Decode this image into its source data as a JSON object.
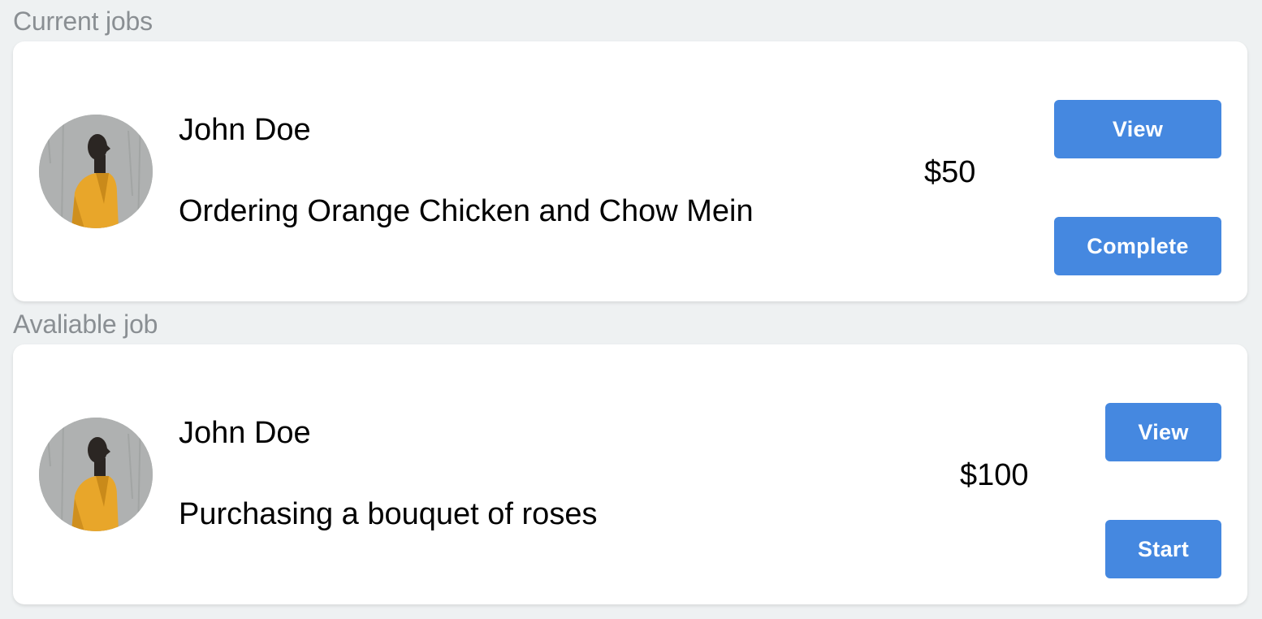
{
  "sections": {
    "current": {
      "title": "Current jobs",
      "job": {
        "name": "John Doe",
        "description": "Ordering Orange Chicken and Chow Mein",
        "price": "$50",
        "primary_button": "View",
        "secondary_button": "Complete"
      }
    },
    "available": {
      "title": "Avaliable job",
      "job": {
        "name": "John Doe",
        "description": "Purchasing a bouquet of roses",
        "price": "$100",
        "primary_button": "View",
        "secondary_button": "Start"
      }
    }
  },
  "avatar": {
    "icon": "person-photo",
    "jacket_color": "#e8a62a",
    "background_color": "#b4b7b6"
  },
  "colors": {
    "accent": "#4588e0",
    "page_background": "#eef1f2",
    "card_background": "#ffffff",
    "section_title": "#8a8f93"
  }
}
